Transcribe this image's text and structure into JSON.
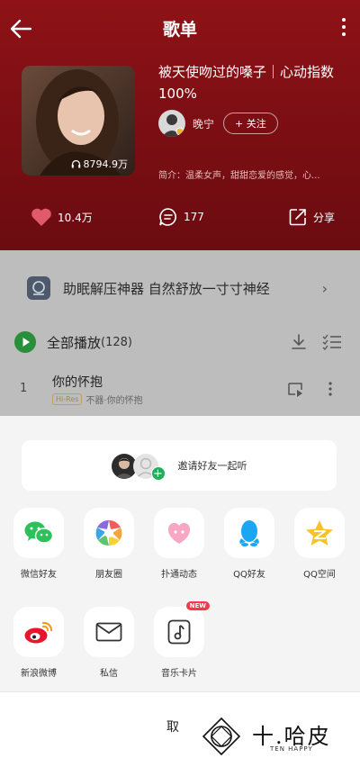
{
  "header": {
    "title": "歌单",
    "playlist_title": "被天使吻过的嗓子｜心动指数100%",
    "play_count": "8794.9万",
    "creator_name": "晚宁",
    "follow_label": "+ 关注",
    "intro": "简介：温柔女声，甜甜恋爱的感觉，心..."
  },
  "actions": {
    "likes": "10.4万",
    "comments": "177",
    "share": "分享"
  },
  "list": {
    "banner_text": "助眠解压神器 自然舒放一寸寸神经",
    "play_all_label": "全部播放",
    "song_count": "(128)",
    "songs": [
      {
        "index": "1",
        "title": "你的怀抱",
        "quality": "Hi-Res",
        "artist_album": "不器·你的怀抱"
      }
    ]
  },
  "share_sheet": {
    "invite_text": "邀请好友一起听",
    "apps": [
      {
        "label": "微信好友"
      },
      {
        "label": "朋友圈"
      },
      {
        "label": "扑通动态"
      },
      {
        "label": "QQ好友"
      },
      {
        "label": "QQ空间"
      },
      {
        "label": "新浪微博"
      },
      {
        "label": "私信"
      },
      {
        "label": "音乐卡片",
        "badge": "NEW"
      }
    ],
    "cancel": "取"
  },
  "watermark": {
    "cn": "十.哈皮",
    "en": "TEN HAPPY"
  },
  "colors": {
    "hero_red": "#8e1217",
    "wechat_green": "#2dc15a",
    "qq_blue": "#1aa6f2",
    "qzone_yellow": "#f6c42a",
    "weibo_red": "#e6162d"
  }
}
